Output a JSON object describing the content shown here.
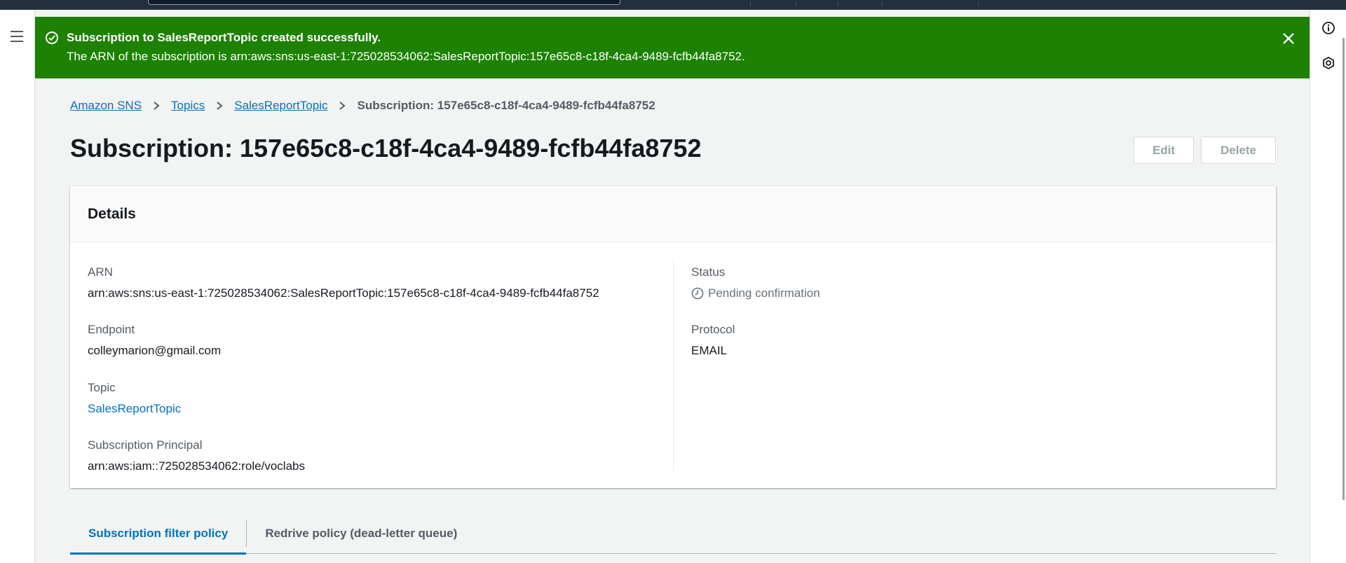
{
  "flash": {
    "title": "Subscription to SalesReportTopic created successfully.",
    "message": "The ARN of the subscription is arn:aws:sns:us-east-1:725028534062:SalesReportTopic:157e65c8-c18f-4ca4-9489-fcfb44fa8752.",
    "color": "#1d8102"
  },
  "breadcrumb": {
    "items": [
      "Amazon SNS",
      "Topics",
      "SalesReportTopic"
    ],
    "current": "Subscription: 157e65c8-c18f-4ca4-9489-fcfb44fa8752"
  },
  "header": {
    "title": "Subscription: 157e65c8-c18f-4ca4-9489-fcfb44fa8752",
    "edit_label": "Edit",
    "delete_label": "Delete"
  },
  "details": {
    "heading": "Details",
    "arn_label": "ARN",
    "arn_value": "arn:aws:sns:us-east-1:725028534062:SalesReportTopic:157e65c8-c18f-4ca4-9489-fcfb44fa8752",
    "endpoint_label": "Endpoint",
    "endpoint_value": "colleymarion@gmail.com",
    "topic_label": "Topic",
    "topic_value": "SalesReportTopic",
    "principal_label": "Subscription Principal",
    "principal_value": "arn:aws:iam::725028534062:role/voclabs",
    "status_label": "Status",
    "status_value": "Pending confirmation",
    "protocol_label": "Protocol",
    "protocol_value": "EMAIL"
  },
  "tabs": [
    {
      "label": "Subscription filter policy",
      "active": true
    },
    {
      "label": "Redrive policy (dead-letter queue)",
      "active": false
    }
  ],
  "icons": {
    "menu": "hamburger-menu-icon",
    "info": "info-icon",
    "settings": "hexagon-settings-icon",
    "success": "check-circle-icon",
    "close": "close-icon",
    "status": "clock-icon",
    "breadcrumb_separator": "chevron-right-icon"
  },
  "colors": {
    "link": "#0073bb",
    "accent": "#0073bb",
    "topbar": "#232f3e"
  }
}
